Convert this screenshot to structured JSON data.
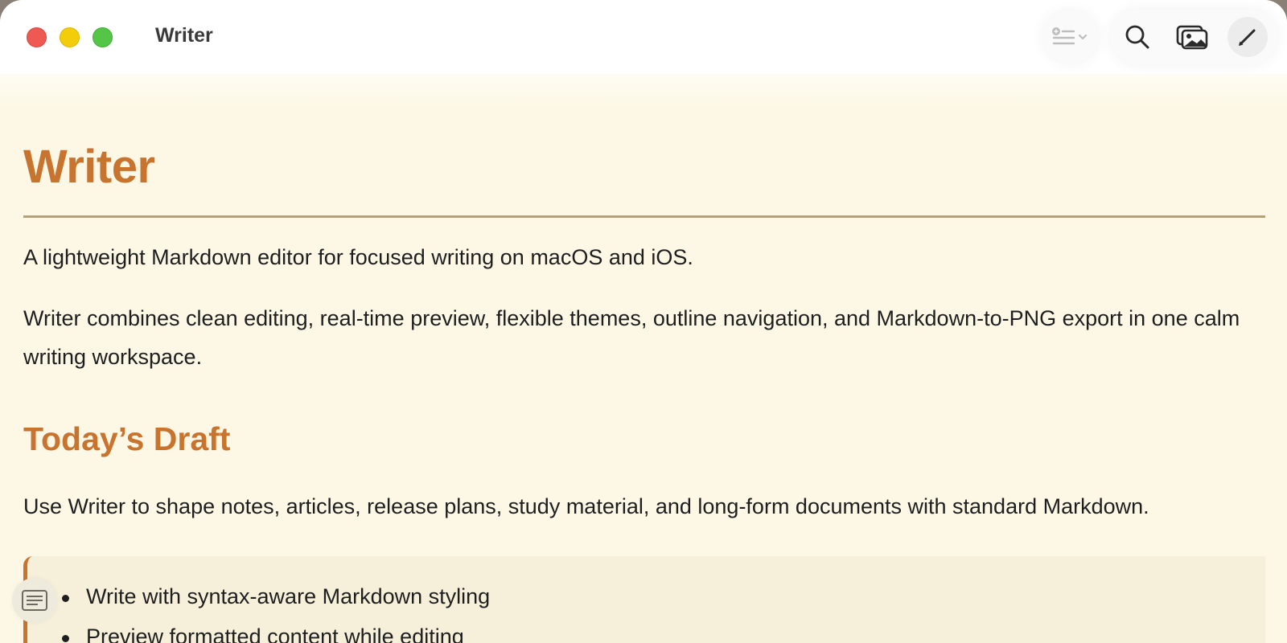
{
  "window": {
    "title": "Writer"
  },
  "toolbar": {
    "outline_icon": "outline-list-icon",
    "search_icon": "magnifier-icon",
    "export_icon": "photo-export-icon",
    "edit_icon": "pencil-icon"
  },
  "document": {
    "title": "Writer",
    "intro": "A lightweight Markdown editor for focused writing on macOS and iOS.",
    "description": "Writer combines clean editing, real-time preview, flexible themes, outline navigation, and Markdown-to-PNG export in one calm writing workspace.",
    "section_heading": "Today’s Draft",
    "section_body": "Use Writer to shape notes, articles, release plans, study material, and long-form documents with standard Markdown.",
    "list_items": [
      "Write with syntax-aware Markdown styling",
      "Preview formatted content while editing"
    ]
  },
  "colors": {
    "accent": "#c8742e",
    "background": "#fdf8e6",
    "quote_background": "#f6f0da",
    "rule": "#b6a27a"
  }
}
